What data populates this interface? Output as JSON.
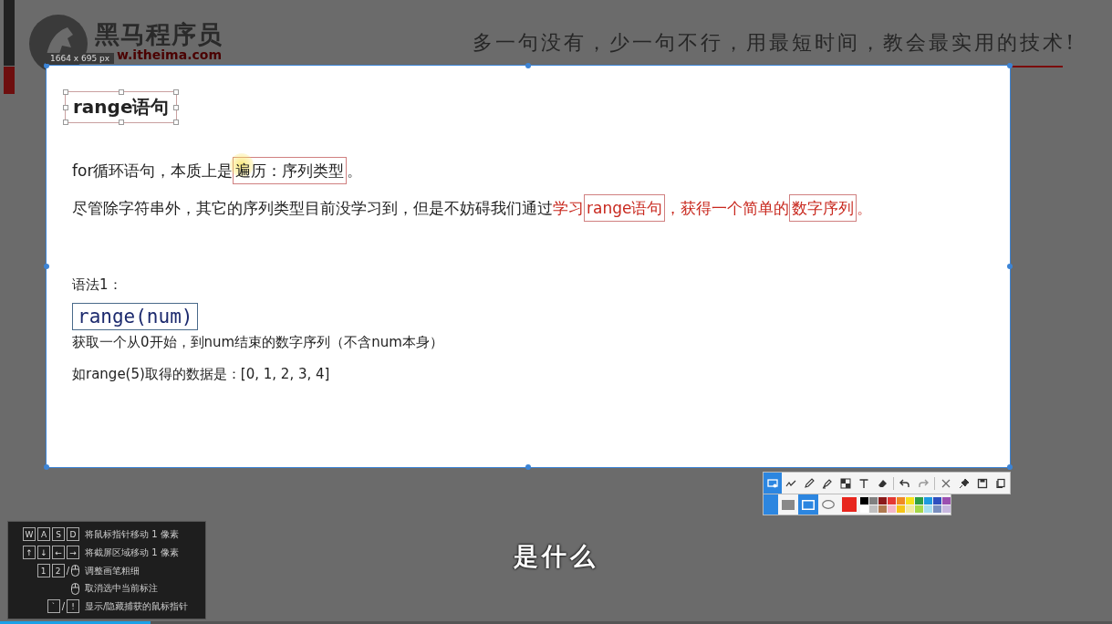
{
  "slide_header": {
    "logo_text": "黑马程序员",
    "logo_url": "w.itheima.com",
    "slogan": "多一句没有，少一句不行，用最短时间，教会最实用的技术!"
  },
  "capture": {
    "size_label": "1664 x 695 px"
  },
  "content": {
    "title": "range语句",
    "paragraphs": [
      [
        {
          "text": "for循环语句，本质上是",
          "kind": "plain",
          "highlight": false
        },
        {
          "text": "遍历：序列类型",
          "kind": "boxed",
          "highlight": true
        },
        {
          "text": "。",
          "kind": "plain",
          "highlight": false
        }
      ],
      [
        {
          "text": "尽管除字符串外，其它的序列类型目前没学习到，但是不妨碍我们通过",
          "kind": "plain",
          "highlight": false
        },
        {
          "text": "学习",
          "kind": "red",
          "highlight": false
        },
        {
          "text": "range语句",
          "kind": "red_boxed",
          "highlight": false
        },
        {
          "text": "，获得一个简单的",
          "kind": "red",
          "highlight": false
        },
        {
          "text": "数字序列",
          "kind": "red_boxed",
          "highlight": false
        },
        {
          "text": "。",
          "kind": "red",
          "highlight": false
        }
      ]
    ],
    "syntax_label": "语法1：",
    "code": "range(num)",
    "description": "获取一个从0开始，到num结束的数字序列（不含num本身）",
    "example": "如range(5)取得的数据是：[0, 1, 2, 3, 4]"
  },
  "toolbar": {
    "tools": [
      {
        "kind": "capture",
        "selected": true
      },
      {
        "kind": "line",
        "selected": false
      },
      {
        "kind": "pencil",
        "selected": false
      },
      {
        "kind": "marker",
        "selected": false
      },
      {
        "kind": "mosaic",
        "selected": false
      },
      {
        "kind": "text",
        "selected": false
      },
      {
        "kind": "eraser",
        "selected": false
      },
      {
        "kind": "divider"
      },
      {
        "kind": "undo",
        "selected": false
      },
      {
        "kind": "redo",
        "selected": false
      },
      {
        "kind": "divider"
      },
      {
        "kind": "close",
        "selected": false
      },
      {
        "kind": "pin",
        "selected": false
      },
      {
        "kind": "save",
        "selected": false
      },
      {
        "kind": "copy",
        "selected": false
      }
    ],
    "shapes": [
      {
        "kind": "filled",
        "selected": false
      },
      {
        "kind": "outline",
        "selected": true
      },
      {
        "kind": "ellipse",
        "selected": false
      }
    ],
    "current": {
      "color": "#e8261e"
    },
    "palette": [
      {
        "color": "#000000",
        "selected": false
      },
      {
        "color": "#808080",
        "selected": false
      },
      {
        "color": "#8b1a1a",
        "selected": false
      },
      {
        "color": "#e53935",
        "selected": false
      },
      {
        "color": "#f08a24",
        "selected": false
      },
      {
        "color": "#f5e11a",
        "selected": false
      },
      {
        "color": "#2e9e44",
        "selected": false
      },
      {
        "color": "#1e9be0",
        "selected": false
      },
      {
        "color": "#2f4fbf",
        "selected": false
      },
      {
        "color": "#9b4fb0",
        "selected": false
      },
      {
        "color": "#ffffff",
        "selected": false
      },
      {
        "color": "#c0c0c0",
        "selected": false
      },
      {
        "color": "#b07a50",
        "selected": false
      },
      {
        "color": "#f4b6c8",
        "selected": false
      },
      {
        "color": "#f5c518",
        "selected": false
      },
      {
        "color": "#f3eaa0",
        "selected": false
      },
      {
        "color": "#a6d84a",
        "selected": false
      },
      {
        "color": "#a8dff0",
        "selected": false
      },
      {
        "color": "#7a8fc0",
        "selected": false
      },
      {
        "color": "#c8b8e0",
        "selected": false
      }
    ]
  },
  "shortcut_hints": [
    {
      "items": [
        {
          "kind": "key",
          "label": "W"
        },
        {
          "kind": "key",
          "label": "A"
        },
        {
          "kind": "key",
          "label": "S"
        },
        {
          "kind": "key",
          "label": "D"
        }
      ],
      "text": "将鼠标指针移动 1 像素"
    },
    {
      "items": [
        {
          "kind": "key",
          "label": "↑"
        },
        {
          "kind": "key",
          "label": "↓"
        },
        {
          "kind": "key",
          "label": "←"
        },
        {
          "kind": "key",
          "label": "→"
        }
      ],
      "text": "将截屏区域移动 1 像素"
    },
    {
      "items": [
        {
          "kind": "key",
          "label": "1"
        },
        {
          "kind": "key",
          "label": "2"
        },
        {
          "kind": "sep",
          "label": "/"
        },
        {
          "kind": "mouse"
        }
      ],
      "text": "调整画笔粗细"
    },
    {
      "items": [
        {
          "kind": "mouse"
        }
      ],
      "text": "取消选中当前标注"
    },
    {
      "items": [
        {
          "kind": "key",
          "label": "`"
        },
        {
          "kind": "sep",
          "label": "/"
        },
        {
          "kind": "key",
          "label": "!"
        }
      ],
      "text": "显示/隐藏捕获的鼠标指针"
    }
  ],
  "subtitle": "是什么",
  "video_progress": {
    "level": 0.135
  }
}
